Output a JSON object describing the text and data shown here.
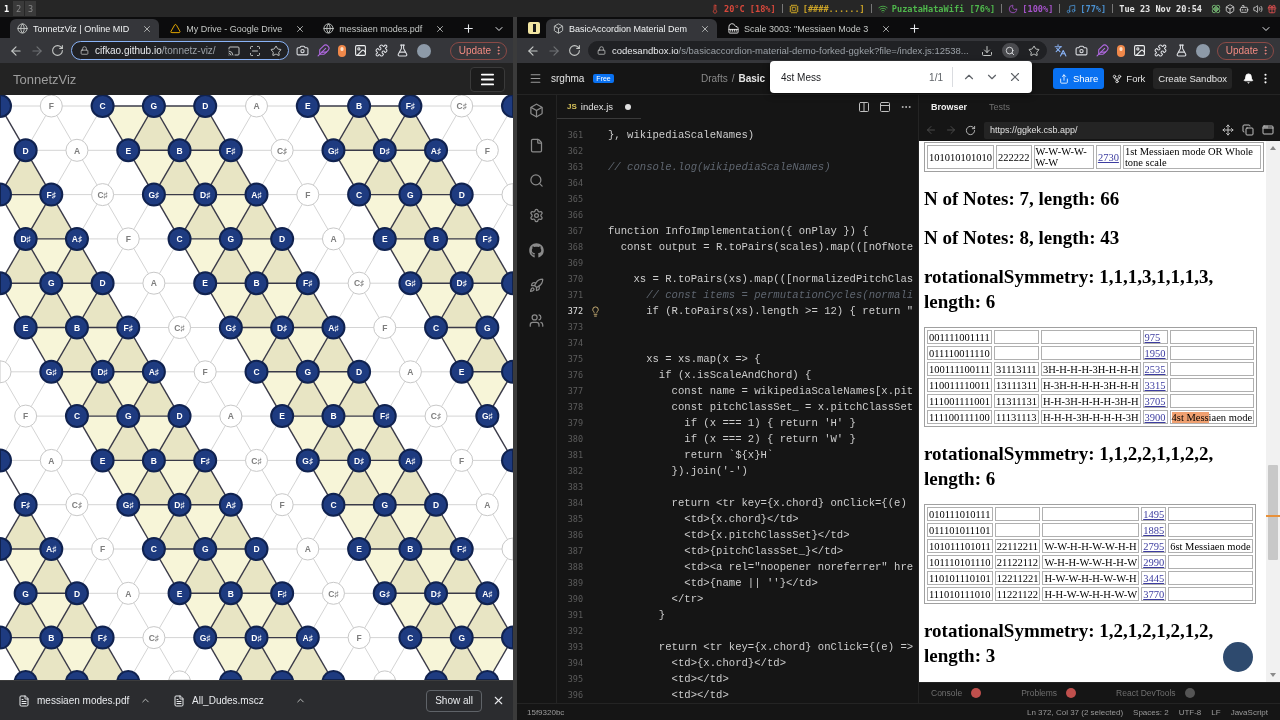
{
  "os_bar": {
    "workspaces": [
      {
        "label": "1",
        "selected": true
      },
      {
        "label": "2",
        "selected": false
      },
      {
        "label": "3",
        "selected": false
      }
    ],
    "status": [
      {
        "kind": "temperature",
        "text": "20°C [18%]",
        "color": "#d9483b"
      },
      {
        "kind": "memory",
        "text": "[####......]",
        "color": "#c9a227"
      },
      {
        "kind": "wifi",
        "text": "PuzataHataWifi [76%]",
        "color": "#4fb84c"
      },
      {
        "kind": "brightness",
        "text": "[100%]",
        "color": "#a552c9"
      },
      {
        "kind": "volume",
        "text": "[77%]",
        "color": "#4a90cf"
      },
      {
        "kind": "clock",
        "text": "Tue 23 Nov 20:54",
        "color": "#e6e6e6"
      }
    ]
  },
  "left_browser": {
    "tabs": [
      {
        "kind": "web",
        "title": "TonnetzViz | Online MID",
        "selected": true
      },
      {
        "kind": "drive",
        "title": "My Drive - Google Drive",
        "selected": false
      },
      {
        "kind": "web",
        "title": "messiaen modes.pdf",
        "selected": false
      }
    ],
    "forward_disabled": true,
    "address": {
      "host": "cifkao.github.io",
      "path": "/tonnetz-viz/",
      "focused": true
    },
    "update": "Update",
    "page_title": "TonnetzViz",
    "tonnetz": {
      "rows": [
        {
          "nodes": [
            {
              "active": true
            },
            {
              "note": "F",
              "active": false
            },
            {
              "note": "C",
              "active": true
            },
            {
              "note": "G",
              "active": true
            },
            {
              "note": "D",
              "active": true
            },
            {
              "note": "A",
              "active": false
            },
            {
              "note": "E",
              "active": true
            },
            {
              "note": "B",
              "active": true
            },
            {
              "note": "F♯",
              "active": true
            },
            {
              "note": "C♯",
              "active": false
            },
            {
              "active": true
            }
          ]
        },
        {
          "nodes": [
            {
              "note": "D",
              "active": true
            },
            {
              "note": "A",
              "active": false
            },
            {
              "note": "E",
              "active": true
            },
            {
              "note": "B",
              "active": true
            },
            {
              "note": "F♯",
              "active": true
            },
            {
              "note": "C♯",
              "active": false
            },
            {
              "note": "G♯",
              "active": true
            },
            {
              "note": "D♯",
              "active": true
            },
            {
              "note": "A♯",
              "active": true
            },
            {
              "note": "F",
              "active": false
            }
          ]
        },
        {
          "nodes": [
            {
              "active": true
            },
            {
              "note": "F♯",
              "active": true
            },
            {
              "note": "C♯",
              "active": false
            },
            {
              "note": "G♯",
              "active": true
            },
            {
              "note": "D♯",
              "active": true
            },
            {
              "note": "A♯",
              "active": true
            },
            {
              "note": "F",
              "active": false
            },
            {
              "note": "C",
              "active": true
            },
            {
              "note": "G",
              "active": true
            },
            {
              "note": "D",
              "active": true
            },
            {
              "active": false
            }
          ]
        },
        {
          "nodes": [
            {
              "note": "D♯",
              "active": true
            },
            {
              "note": "A♯",
              "active": true
            },
            {
              "note": "F",
              "active": false
            },
            {
              "note": "C",
              "active": true
            },
            {
              "note": "G",
              "active": true
            },
            {
              "note": "D",
              "active": true
            },
            {
              "note": "A",
              "active": false
            },
            {
              "note": "E",
              "active": true
            },
            {
              "note": "B",
              "active": true
            },
            {
              "note": "F♯",
              "active": true
            }
          ]
        },
        {
          "nodes": [
            {
              "active": true
            },
            {
              "note": "G",
              "active": true
            },
            {
              "note": "D",
              "active": true
            },
            {
              "note": "A",
              "active": false
            },
            {
              "note": "E",
              "active": true
            },
            {
              "note": "B",
              "active": true
            },
            {
              "note": "F♯",
              "active": true
            },
            {
              "note": "C♯",
              "active": false
            },
            {
              "note": "G♯",
              "active": true
            },
            {
              "note": "D♯",
              "active": true
            },
            {
              "active": true
            }
          ]
        },
        {
          "nodes": [
            {
              "note": "E",
              "active": true
            },
            {
              "note": "B",
              "active": true
            },
            {
              "note": "F♯",
              "active": true
            },
            {
              "note": "C♯",
              "active": false
            },
            {
              "note": "G♯",
              "active": true
            },
            {
              "note": "D♯",
              "active": true
            },
            {
              "note": "A♯",
              "active": true
            },
            {
              "note": "F",
              "active": false
            },
            {
              "note": "C",
              "active": true
            },
            {
              "note": "G",
              "active": true
            }
          ]
        },
        {
          "nodes": [
            {
              "active": false
            },
            {
              "note": "G♯",
              "active": true
            },
            {
              "note": "D♯",
              "active": true
            },
            {
              "note": "A♯",
              "active": true
            },
            {
              "note": "F",
              "active": false
            },
            {
              "note": "C",
              "active": true
            },
            {
              "note": "G",
              "active": true
            },
            {
              "note": "D",
              "active": true
            },
            {
              "note": "A",
              "active": false
            },
            {
              "note": "E",
              "active": true
            },
            {
              "active": true
            }
          ]
        },
        {
          "nodes": [
            {
              "note": "F",
              "active": false
            },
            {
              "note": "C",
              "active": true
            },
            {
              "note": "G",
              "active": true
            },
            {
              "note": "D",
              "active": true
            },
            {
              "note": "A",
              "active": false
            },
            {
              "note": "E",
              "active": true
            },
            {
              "note": "B",
              "active": true
            },
            {
              "note": "F♯",
              "active": true
            },
            {
              "note": "C♯",
              "active": false
            },
            {
              "note": "G♯",
              "active": true
            }
          ]
        },
        {
          "nodes": [
            {
              "active": true
            },
            {
              "note": "A",
              "active": false
            },
            {
              "note": "E",
              "active": true
            },
            {
              "note": "B",
              "active": true
            },
            {
              "note": "F♯",
              "active": true
            },
            {
              "note": "C♯",
              "active": false
            },
            {
              "note": "G♯",
              "active": true
            },
            {
              "note": "D♯",
              "active": true
            },
            {
              "note": "A♯",
              "active": true
            },
            {
              "note": "F",
              "active": false
            },
            {
              "active": true
            }
          ]
        },
        {
          "nodes": [
            {
              "note": "F♯",
              "active": true
            },
            {
              "note": "C♯",
              "active": false
            },
            {
              "note": "G♯",
              "active": true
            },
            {
              "note": "D♯",
              "active": true
            },
            {
              "note": "A♯",
              "active": true
            },
            {
              "note": "F",
              "active": false
            },
            {
              "note": "C",
              "active": true
            },
            {
              "note": "G",
              "active": true
            },
            {
              "note": "D",
              "active": true
            },
            {
              "note": "A",
              "active": false
            }
          ]
        },
        {
          "nodes": [
            {
              "active": true
            },
            {
              "note": "A♯",
              "active": true
            },
            {
              "note": "F",
              "active": false
            },
            {
              "note": "C",
              "active": true
            },
            {
              "note": "G",
              "active": true
            },
            {
              "note": "D",
              "active": true
            },
            {
              "note": "A",
              "active": false
            },
            {
              "note": "E",
              "active": true
            },
            {
              "note": "B",
              "active": true
            },
            {
              "note": "F♯",
              "active": true
            },
            {
              "active": false
            }
          ]
        },
        {
          "nodes": [
            {
              "note": "G",
              "active": true
            },
            {
              "note": "D",
              "active": true
            },
            {
              "note": "A",
              "active": false
            },
            {
              "note": "E",
              "active": true
            },
            {
              "note": "B",
              "active": true
            },
            {
              "note": "F♯",
              "active": true
            },
            {
              "note": "C♯",
              "active": false
            },
            {
              "note": "G♯",
              "active": true
            },
            {
              "note": "D♯",
              "active": true
            },
            {
              "note": "A♯",
              "active": true
            }
          ]
        },
        {
          "nodes": [
            {
              "active": true
            },
            {
              "note": "B",
              "active": true
            },
            {
              "note": "F♯",
              "active": true
            },
            {
              "note": "C♯",
              "active": false
            },
            {
              "note": "G♯",
              "active": true
            },
            {
              "note": "D♯",
              "active": true
            },
            {
              "note": "A♯",
              "active": true
            },
            {
              "note": "F",
              "active": false
            },
            {
              "note": "C",
              "active": true
            },
            {
              "note": "G",
              "active": true
            },
            {
              "active": true
            }
          ]
        },
        {
          "nodes": [
            {
              "active": true
            },
            {
              "active": true
            },
            {
              "active": true
            },
            {
              "active": false
            },
            {
              "active": true
            },
            {
              "active": true
            },
            {
              "active": true
            },
            {
              "active": false
            },
            {
              "active": true
            },
            {
              "active": true
            }
          ]
        }
      ]
    },
    "downloads": [
      {
        "name": "messiaen modes.pdf"
      },
      {
        "name": "All_Dudes.mscz"
      }
    ],
    "show_all": "Show all"
  },
  "right_browser": {
    "tabs": [
      {
        "kind": "sandbox",
        "title": "BasicAccordion Material Dem",
        "selected": true
      },
      {
        "kind": "music",
        "title": "Scale 3003: \"Messiaen Mode 3",
        "selected": false
      }
    ],
    "forward_disabled": true,
    "address": {
      "host": "codesandbox.io",
      "path": "/s/basicaccordion-material-demo-forked-ggkek?file=/index.js:12538...",
      "focused": false
    },
    "update": "Update",
    "find_bar": {
      "query": "4st Mess",
      "count": "1/1"
    },
    "sandbox": {
      "user": "srghma",
      "plan": "Free",
      "breadcrumb": [
        "Drafts",
        "/",
        "Basic"
      ],
      "share": "Share",
      "fork": "Fork",
      "create": "Create Sandbox",
      "editor": {
        "file_badge": "JS",
        "file": "index.js",
        "modified": true,
        "lines": [
          {
            "n": "361",
            "kind": "code",
            "code": "}, wikipediaScaleNames)",
            "current": false
          },
          {
            "n": "362",
            "current": false
          },
          {
            "n": "363",
            "kind": "comment",
            "code": "// console.log(wikipediaScaleNames)",
            "current": false
          },
          {
            "n": "364",
            "current": false
          },
          {
            "n": "365",
            "current": false
          },
          {
            "n": "366",
            "current": false
          },
          {
            "n": "367",
            "kind": "code",
            "code": "function InfoImplementation({ onPlay }) {",
            "current": false
          },
          {
            "n": "368",
            "kind": "code",
            "code": "  const output = R.toPairs(scales).map(([nOfNote",
            "current": false
          },
          {
            "n": "369",
            "current": false
          },
          {
            "n": "370",
            "kind": "code",
            "code": "    xs = R.toPairs(xs).map(([normalizedPitchClas",
            "current": false
          },
          {
            "n": "371",
            "kind": "comment",
            "code": "      // const items = permutationCycles(normali",
            "current": false
          },
          {
            "n": "372",
            "kind": "code",
            "code": "      if (R.toPairs(xs).length >= 12) { return \"",
            "current": true
          },
          {
            "n": "373",
            "current": false
          },
          {
            "n": "374",
            "current": false
          },
          {
            "n": "375",
            "kind": "code",
            "code": "      xs = xs.map(x => {",
            "current": false
          },
          {
            "n": "376",
            "kind": "code",
            "code": "        if (x.isScaleAndChord) {",
            "current": false
          },
          {
            "n": "377",
            "kind": "code",
            "code": "          const name = wikipediaScaleNames[x.pit",
            "current": false
          },
          {
            "n": "378",
            "kind": "code",
            "code": "          const pitchClassSet_ = x.pitchClassSet",
            "current": false
          },
          {
            "n": "379",
            "kind": "code",
            "code": "            if (x === 1) { return 'H' }",
            "current": false
          },
          {
            "n": "380",
            "kind": "code",
            "code": "            if (x === 2) { return 'W' }",
            "current": false
          },
          {
            "n": "381",
            "kind": "code",
            "code": "            return `${x}H`",
            "current": false
          },
          {
            "n": "382",
            "kind": "code",
            "code": "          }).join('-')",
            "current": false
          },
          {
            "n": "383",
            "current": false
          },
          {
            "n": "384",
            "kind": "code",
            "code": "          return <tr key={x.chord} onClick={(e)",
            "current": false
          },
          {
            "n": "385",
            "kind": "code",
            "code": "            <td>{x.chord}</td>",
            "current": false
          },
          {
            "n": "386",
            "kind": "code",
            "code": "            <td>{x.pitchClassSet}</td>",
            "current": false
          },
          {
            "n": "387",
            "kind": "code",
            "code": "            <td>{pitchClassSet_}</td>",
            "current": false
          },
          {
            "n": "388",
            "kind": "code",
            "code": "            <td><a rel=\"noopener noreferrer\" hre",
            "current": false
          },
          {
            "n": "389",
            "kind": "code",
            "code": "            <td>{name || ''}</td>",
            "current": false
          },
          {
            "n": "390",
            "kind": "code",
            "code": "          </tr>",
            "current": false
          },
          {
            "n": "391",
            "kind": "code",
            "code": "        }",
            "current": false
          },
          {
            "n": "392",
            "current": false
          },
          {
            "n": "393",
            "kind": "code",
            "code": "        return <tr key={x.chord} onClick={(e) =>",
            "current": false
          },
          {
            "n": "394",
            "kind": "code",
            "code": "          <td>{x.chord}</td>",
            "current": false
          },
          {
            "n": "395",
            "kind": "code",
            "code": "          <td></td>",
            "current": false
          },
          {
            "n": "396",
            "kind": "code",
            "code": "          <td></td>",
            "current": false
          }
        ]
      },
      "preview": {
        "tabs": [
          {
            "label": "Browser",
            "selected": true
          },
          {
            "label": "Tests",
            "selected": false
          }
        ],
        "back_disabled": true,
        "forward_disabled": true,
        "url": "https://ggkek.csb.app/",
        "blocks": [
          {
            "kind": "table",
            "rows": [
              {
                "chord": "101010101010",
                "pcs": "222222",
                "steps": "W-W-W-W-W-W",
                "link": "2730",
                "name": "1st Messiaen mode OR Whole tone scale"
              }
            ]
          },
          {
            "kind": "heading",
            "text": "N of Notes: 7, length: 66"
          },
          {
            "kind": "heading",
            "text": "N of Notes: 8, length: 43"
          },
          {
            "kind": "heading",
            "text": "rotationalSymmetry: 1,1,1,3,1,1,1,3, length: 6"
          },
          {
            "kind": "table",
            "rows": [
              {
                "chord": "001111001111",
                "link": "975"
              },
              {
                "chord": "011110011110",
                "link": "1950"
              },
              {
                "chord": "100111100111",
                "pcs": "31113111",
                "steps": "3H-H-H-H-3H-H-H-H",
                "link": "2535"
              },
              {
                "chord": "110011110011",
                "pcs": "13111311",
                "steps": "H-3H-H-H-H-3H-H-H",
                "link": "3315"
              },
              {
                "chord": "111001111001",
                "pcs": "11311131",
                "steps": "H-H-3H-H-H-H-3H-H",
                "link": "3705"
              },
              {
                "chord": "111100111100",
                "pcs": "11131113",
                "steps": "H-H-H-3H-H-H-H-3H",
                "link": "3900",
                "name_parts": [
                  {
                    "text": "4st Mess",
                    "match": true
                  },
                  {
                    "text": "iaen mode",
                    "match": false
                  }
                ]
              }
            ]
          },
          {
            "kind": "heading",
            "text": "rotationalSymmetry: 1,1,2,2,1,1,2,2, length: 6"
          },
          {
            "kind": "table",
            "rows": [
              {
                "chord": "010111010111",
                "link": "1495"
              },
              {
                "chord": "011101011101",
                "link": "1885"
              },
              {
                "chord": "101011101011",
                "pcs": "22112211",
                "steps": "W-W-H-H-W-W-H-H",
                "link": "2795",
                "name": "6st Messiaen mode"
              },
              {
                "chord": "101110101110",
                "pcs": "21122112",
                "steps": "W-H-H-W-W-H-H-W",
                "link": "2990"
              },
              {
                "chord": "110101110101",
                "pcs": "12211221",
                "steps": "H-W-W-H-H-W-W-H",
                "link": "3445"
              },
              {
                "chord": "111010111010",
                "pcs": "11221122",
                "steps": "H-H-W-W-H-H-W-W",
                "link": "3770"
              }
            ]
          },
          {
            "kind": "heading",
            "text": "rotationalSymmetry: 1,2,1,2,1,2,1,2, length: 3"
          }
        ],
        "devtools": [
          {
            "label": "Console",
            "color": "#c0504d"
          },
          {
            "label": "Problems",
            "color": "#c0504d"
          },
          {
            "label": "React DevTools",
            "color": "#555555"
          }
        ]
      },
      "status": {
        "commit": "15f9320bc",
        "items": [
          "Ln 372, Col 37 (2 selected)",
          "Spaces: 2",
          "UTF-8",
          "LF",
          "JavaScript"
        ]
      }
    }
  }
}
